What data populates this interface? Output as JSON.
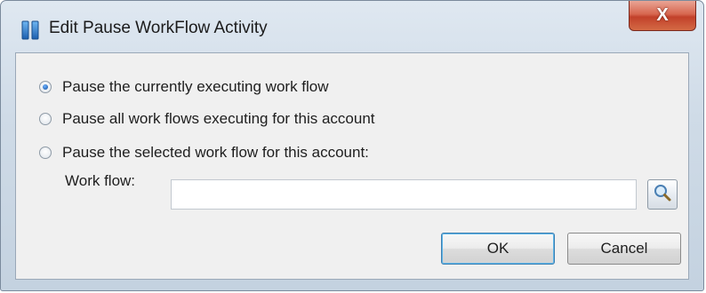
{
  "window": {
    "title": "Edit Pause WorkFlow Activity",
    "close_label": "X",
    "title_icon": "pause-icon",
    "accent_color": "#2a6fc9"
  },
  "options": [
    {
      "label": "Pause the currently executing work flow",
      "selected": true
    },
    {
      "label": "Pause all work flows executing for this account",
      "selected": false
    },
    {
      "label": "Pause the selected work flow for this account:",
      "selected": false
    }
  ],
  "workflow": {
    "label": "Work flow:",
    "value": "",
    "search_icon": "magnifier-icon"
  },
  "buttons": {
    "ok_label": "OK",
    "cancel_label": "Cancel"
  }
}
